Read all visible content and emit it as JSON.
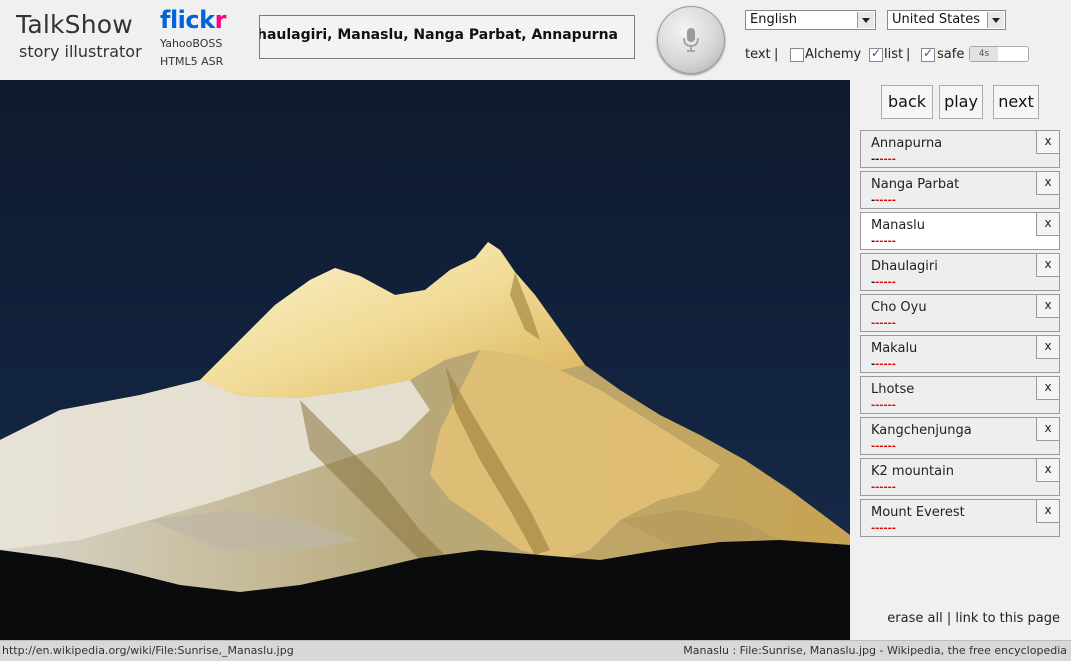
{
  "brand": {
    "title": "TalkShow",
    "subtitle": "story illustrator",
    "flickr_part1": "flick",
    "flickr_part2": "r",
    "provider1": "YahooBOSS",
    "provider2": "HTML5 ASR"
  },
  "transcript": "Oyu, Dhaulagiri, Manaslu, Nanga Parbat, Annapurna",
  "mic_icon": "microphone-icon",
  "settings": {
    "language": "English",
    "country": "United States",
    "text_label": "text",
    "sep": "|",
    "alchemy_label": "Alchemy",
    "alchemy_checked": false,
    "list_label": "list",
    "list_checked": true,
    "safe_label": "safe",
    "safe_checked": true,
    "speed_value": "4s"
  },
  "nav": {
    "back": "back",
    "play": "play",
    "next": "next"
  },
  "history": [
    {
      "label": "Annapurna",
      "dash_black": "--",
      "dash_red": "----",
      "active": false
    },
    {
      "label": "Nanga Parbat",
      "dash_black": "-",
      "dash_red": "-----",
      "active": false
    },
    {
      "label": "Manaslu",
      "dash_black": "-",
      "dash_red": "-----",
      "active": true
    },
    {
      "label": "Dhaulagiri",
      "dash_black": "-",
      "dash_red": "-----",
      "active": false
    },
    {
      "label": "Cho Oyu",
      "dash_black": "",
      "dash_red": "------",
      "active": false
    },
    {
      "label": "Makalu",
      "dash_black": "-",
      "dash_red": "-----",
      "active": false
    },
    {
      "label": "Lhotse",
      "dash_black": "",
      "dash_red": "------",
      "active": false
    },
    {
      "label": "Kangchenjunga",
      "dash_black": "",
      "dash_red": "------",
      "active": false
    },
    {
      "label": "K2 mountain",
      "dash_black": "",
      "dash_red": "------",
      "active": false
    },
    {
      "label": "Mount Everest",
      "dash_black": "",
      "dash_red": "------",
      "active": false
    }
  ],
  "remove_label": "x",
  "footer": {
    "erase_all": "erase all",
    "sep": "|",
    "link": "link to this page"
  },
  "status": {
    "url": "http://en.wikipedia.org/wiki/File:Sunrise,_Manaslu.jpg",
    "caption": "Manaslu : File:Sunrise, Manaslu.jpg - Wikipedia, the free encyclopedia"
  },
  "colors": {
    "flickr_blue": "#0063dc",
    "flickr_pink": "#ff0084",
    "dash_red": "#e00000"
  }
}
